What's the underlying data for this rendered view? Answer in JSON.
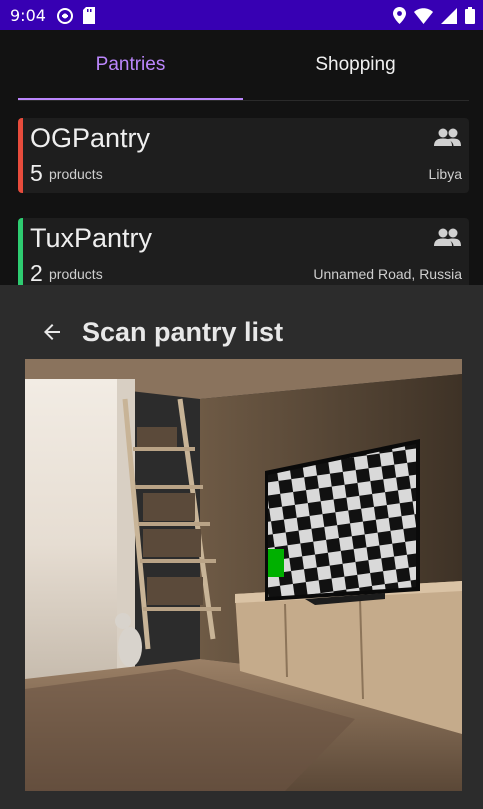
{
  "status_bar": {
    "time": "9:04",
    "icons_left": [
      "no-disturb-icon",
      "sd-card-icon"
    ],
    "icons_right": [
      "location-icon",
      "wifi-icon",
      "signal-icon",
      "battery-icon"
    ],
    "background": "#3700b3"
  },
  "tabs": [
    {
      "label": "Pantries",
      "selected": true
    },
    {
      "label": "Shopping",
      "selected": false
    }
  ],
  "accent_color": "#bb86fc",
  "pantries": [
    {
      "name": "OGPantry",
      "count": "5",
      "count_label": "products",
      "location": "Libya",
      "accent": "#e74c3c",
      "icon": "group-icon"
    },
    {
      "name": "TuxPantry",
      "count": "2",
      "count_label": "products",
      "location": "Unnamed Road, Russia",
      "accent": "#2ecc71",
      "icon": "group-icon"
    }
  ],
  "scan_sheet": {
    "title": "Scan pantry list",
    "back_icon": "arrow-back-icon",
    "image": "camera-preview-room-with-tv-checkerboard"
  }
}
